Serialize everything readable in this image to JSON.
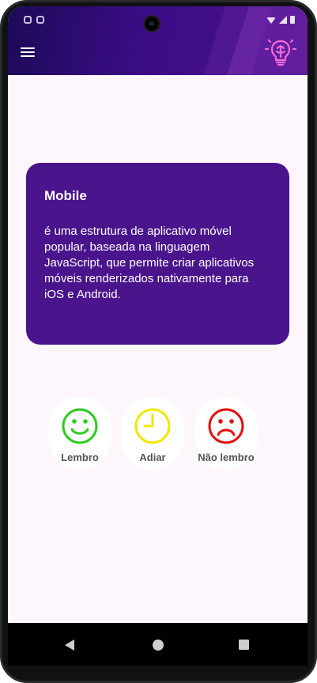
{
  "header": {
    "menu_icon": "hamburger-menu-icon",
    "action_icon": "lightbulb-brain-icon",
    "accent": "#f06ad8"
  },
  "card": {
    "title": "Mobile",
    "text": "é uma estrutura de aplicativo móvel popular, baseada na linguagem JavaScript, que permite criar aplicativos móveis renderizados nativamente para iOS e Android.",
    "color": "#4a148c"
  },
  "answers": [
    {
      "label": "Lembro",
      "icon": "smile-face-icon",
      "color": "#2ecc1e"
    },
    {
      "label": "Adiar",
      "icon": "clock-icon",
      "color": "#f0e800"
    },
    {
      "label": "Não lembro",
      "icon": "sad-face-icon",
      "color": "#e01010"
    }
  ],
  "navbar": {
    "back_icon": "back-triangle-icon",
    "home_icon": "home-circle-icon",
    "recents_icon": "recents-square-icon"
  }
}
